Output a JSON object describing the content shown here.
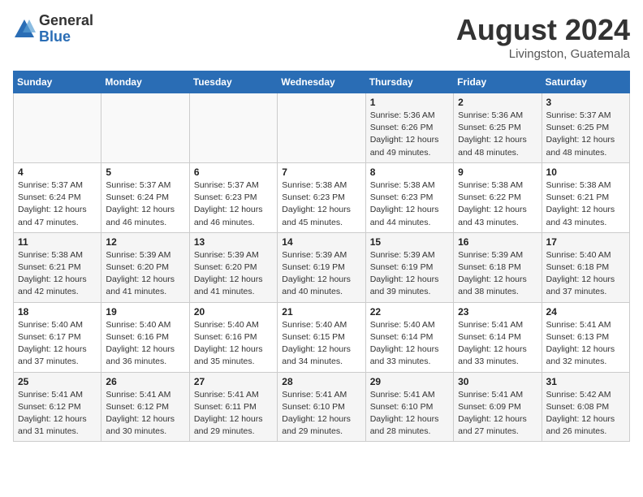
{
  "logo": {
    "general": "General",
    "blue": "Blue"
  },
  "title": "August 2024",
  "location": "Livingston, Guatemala",
  "days_header": [
    "Sunday",
    "Monday",
    "Tuesday",
    "Wednesday",
    "Thursday",
    "Friday",
    "Saturday"
  ],
  "weeks": [
    [
      {
        "day": "",
        "info": ""
      },
      {
        "day": "",
        "info": ""
      },
      {
        "day": "",
        "info": ""
      },
      {
        "day": "",
        "info": ""
      },
      {
        "day": "1",
        "info": "Sunrise: 5:36 AM\nSunset: 6:26 PM\nDaylight: 12 hours\nand 49 minutes."
      },
      {
        "day": "2",
        "info": "Sunrise: 5:36 AM\nSunset: 6:25 PM\nDaylight: 12 hours\nand 48 minutes."
      },
      {
        "day": "3",
        "info": "Sunrise: 5:37 AM\nSunset: 6:25 PM\nDaylight: 12 hours\nand 48 minutes."
      }
    ],
    [
      {
        "day": "4",
        "info": "Sunrise: 5:37 AM\nSunset: 6:24 PM\nDaylight: 12 hours\nand 47 minutes."
      },
      {
        "day": "5",
        "info": "Sunrise: 5:37 AM\nSunset: 6:24 PM\nDaylight: 12 hours\nand 46 minutes."
      },
      {
        "day": "6",
        "info": "Sunrise: 5:37 AM\nSunset: 6:23 PM\nDaylight: 12 hours\nand 46 minutes."
      },
      {
        "day": "7",
        "info": "Sunrise: 5:38 AM\nSunset: 6:23 PM\nDaylight: 12 hours\nand 45 minutes."
      },
      {
        "day": "8",
        "info": "Sunrise: 5:38 AM\nSunset: 6:23 PM\nDaylight: 12 hours\nand 44 minutes."
      },
      {
        "day": "9",
        "info": "Sunrise: 5:38 AM\nSunset: 6:22 PM\nDaylight: 12 hours\nand 43 minutes."
      },
      {
        "day": "10",
        "info": "Sunrise: 5:38 AM\nSunset: 6:21 PM\nDaylight: 12 hours\nand 43 minutes."
      }
    ],
    [
      {
        "day": "11",
        "info": "Sunrise: 5:38 AM\nSunset: 6:21 PM\nDaylight: 12 hours\nand 42 minutes."
      },
      {
        "day": "12",
        "info": "Sunrise: 5:39 AM\nSunset: 6:20 PM\nDaylight: 12 hours\nand 41 minutes."
      },
      {
        "day": "13",
        "info": "Sunrise: 5:39 AM\nSunset: 6:20 PM\nDaylight: 12 hours\nand 41 minutes."
      },
      {
        "day": "14",
        "info": "Sunrise: 5:39 AM\nSunset: 6:19 PM\nDaylight: 12 hours\nand 40 minutes."
      },
      {
        "day": "15",
        "info": "Sunrise: 5:39 AM\nSunset: 6:19 PM\nDaylight: 12 hours\nand 39 minutes."
      },
      {
        "day": "16",
        "info": "Sunrise: 5:39 AM\nSunset: 6:18 PM\nDaylight: 12 hours\nand 38 minutes."
      },
      {
        "day": "17",
        "info": "Sunrise: 5:40 AM\nSunset: 6:18 PM\nDaylight: 12 hours\nand 37 minutes."
      }
    ],
    [
      {
        "day": "18",
        "info": "Sunrise: 5:40 AM\nSunset: 6:17 PM\nDaylight: 12 hours\nand 37 minutes."
      },
      {
        "day": "19",
        "info": "Sunrise: 5:40 AM\nSunset: 6:16 PM\nDaylight: 12 hours\nand 36 minutes."
      },
      {
        "day": "20",
        "info": "Sunrise: 5:40 AM\nSunset: 6:16 PM\nDaylight: 12 hours\nand 35 minutes."
      },
      {
        "day": "21",
        "info": "Sunrise: 5:40 AM\nSunset: 6:15 PM\nDaylight: 12 hours\nand 34 minutes."
      },
      {
        "day": "22",
        "info": "Sunrise: 5:40 AM\nSunset: 6:14 PM\nDaylight: 12 hours\nand 33 minutes."
      },
      {
        "day": "23",
        "info": "Sunrise: 5:41 AM\nSunset: 6:14 PM\nDaylight: 12 hours\nand 33 minutes."
      },
      {
        "day": "24",
        "info": "Sunrise: 5:41 AM\nSunset: 6:13 PM\nDaylight: 12 hours\nand 32 minutes."
      }
    ],
    [
      {
        "day": "25",
        "info": "Sunrise: 5:41 AM\nSunset: 6:12 PM\nDaylight: 12 hours\nand 31 minutes."
      },
      {
        "day": "26",
        "info": "Sunrise: 5:41 AM\nSunset: 6:12 PM\nDaylight: 12 hours\nand 30 minutes."
      },
      {
        "day": "27",
        "info": "Sunrise: 5:41 AM\nSunset: 6:11 PM\nDaylight: 12 hours\nand 29 minutes."
      },
      {
        "day": "28",
        "info": "Sunrise: 5:41 AM\nSunset: 6:10 PM\nDaylight: 12 hours\nand 29 minutes."
      },
      {
        "day": "29",
        "info": "Sunrise: 5:41 AM\nSunset: 6:10 PM\nDaylight: 12 hours\nand 28 minutes."
      },
      {
        "day": "30",
        "info": "Sunrise: 5:41 AM\nSunset: 6:09 PM\nDaylight: 12 hours\nand 27 minutes."
      },
      {
        "day": "31",
        "info": "Sunrise: 5:42 AM\nSunset: 6:08 PM\nDaylight: 12 hours\nand 26 minutes."
      }
    ]
  ]
}
